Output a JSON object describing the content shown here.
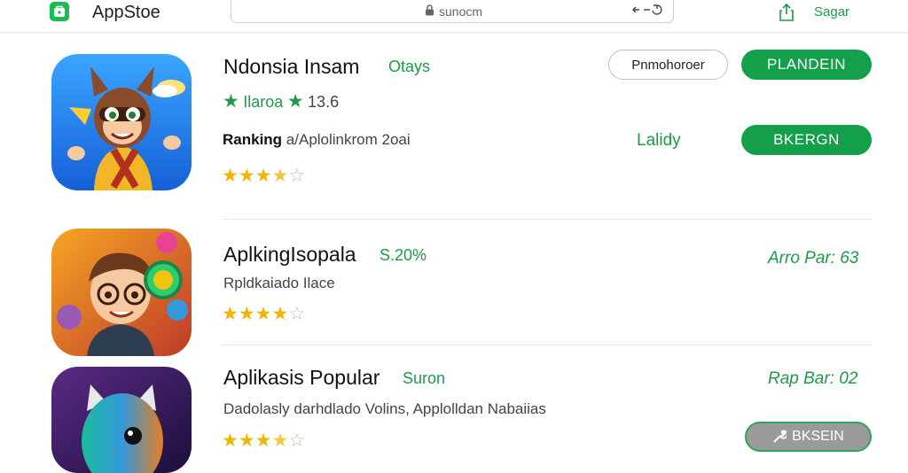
{
  "header": {
    "brand": "AppStoe",
    "url": "sunocm",
    "share_label": "Sagar"
  },
  "apps": [
    {
      "title": "Ndonsia Insam",
      "tag": "Otays",
      "rating_line": {
        "label": "Ilaroa",
        "count": "13.6"
      },
      "ranking": {
        "label": "Ranking",
        "text": "a/Aplolinkrom 2oai"
      },
      "stars": 3.5,
      "status": "Lalidy",
      "secondary_button": "Pnmohoroer",
      "primary_button": "PLANDEIN",
      "action_button": "BKERGN"
    },
    {
      "title": "AplkingIsopala",
      "tag": "S.20%",
      "subtitle": "Rpldkaiado Ilace",
      "stars": 4,
      "price": "Arro Par: 63"
    },
    {
      "title": "Aplikasis Popular",
      "tag": "Suron",
      "subtitle": "Dadolasly darhdlado Volins, Applolldan Nabaiias",
      "stars": 3.5,
      "price": "Rap Bar: 02",
      "button": "BKSEIN"
    }
  ],
  "colors": {
    "accent": "#1c9a45",
    "star": "#f1b400"
  }
}
